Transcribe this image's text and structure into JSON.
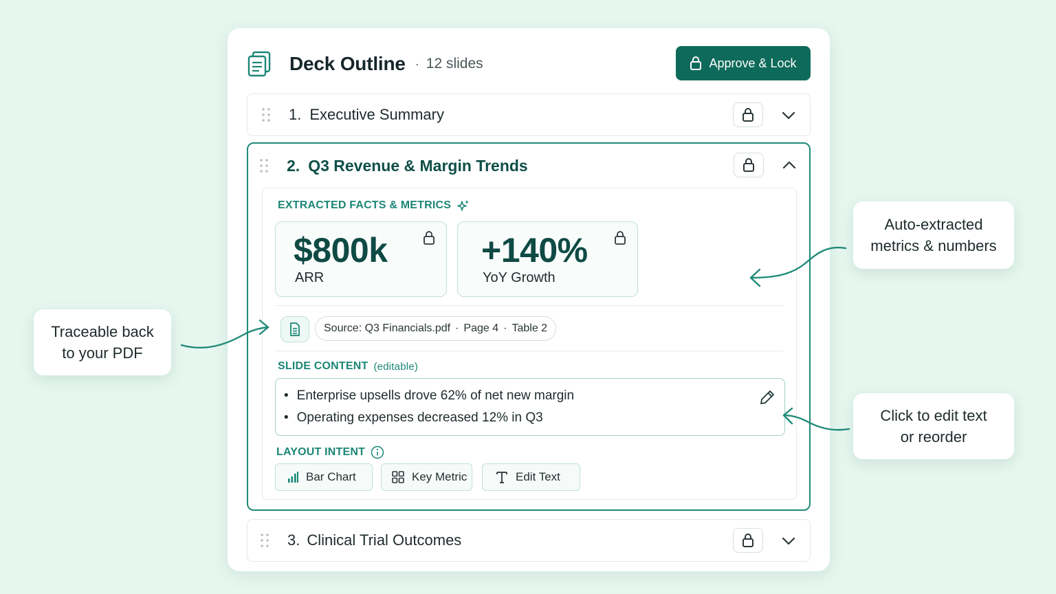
{
  "header": {
    "title": "Deck Outline",
    "separator": "·",
    "slide_count": "12 slides",
    "approve_label": "Approve & Lock"
  },
  "slides": [
    {
      "number": "1.",
      "title": "Executive Summary"
    },
    {
      "number": "2.",
      "title": "Q3 Revenue & Margin Trends"
    },
    {
      "number": "3.",
      "title": "Clinical Trial Outcomes"
    }
  ],
  "expanded": {
    "facts_label": "EXTRACTED FACTS & METRICS",
    "metrics": [
      {
        "value": "$800k",
        "label": "ARR"
      },
      {
        "value": "+140%",
        "label": "YoY Growth"
      }
    ],
    "source": {
      "file": "Source: Q3 Financials.pdf",
      "sep": "·",
      "page": "Page 4",
      "table": "Table 2"
    },
    "content_label": "SLIDE CONTENT",
    "content_hint": "(editable)",
    "bullet_char": "•",
    "bullets": [
      "Enterprise upsells drove 62% of net new margin",
      "Operating expenses decreased 12% in Q3"
    ],
    "layout_label": "LAYOUT INTENT",
    "layout_options": [
      "Bar Chart",
      "Key Metric",
      "Edit Text"
    ]
  },
  "callouts": {
    "pdf": [
      "Traceable back",
      "to your PDF"
    ],
    "metrics": [
      "Auto-extracted",
      "metrics & numbers"
    ],
    "edit": [
      "Click to edit text",
      "or reorder"
    ]
  },
  "colors": {
    "accent": "#0e6a5a",
    "teal": "#1b8676",
    "background": "#e6f7ef"
  },
  "icons": [
    "deck-icon",
    "lock-icon",
    "chevron-down-icon",
    "chevron-up-icon",
    "drag-handle-icon",
    "sparkle-icon",
    "document-icon",
    "pencil-icon",
    "info-icon",
    "bar-chart-icon",
    "grid-icon",
    "text-icon"
  ]
}
